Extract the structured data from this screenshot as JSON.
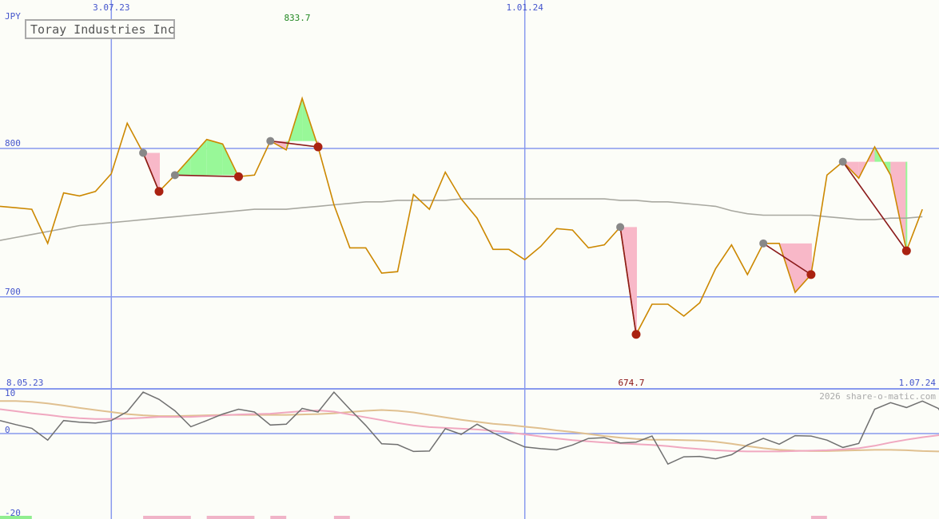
{
  "chart_data": {
    "type": "line",
    "title": "Toray Industries Inc",
    "currency": "JPY",
    "watermark": "2026 share-o-matic.com",
    "price_labels": {
      "high": "833.7",
      "low": "674.7"
    },
    "date_labels": {
      "start": "8.05.23",
      "end": "1.07.24"
    },
    "main_panel": {
      "y_ticks": [
        {
          "value": 800,
          "label": "800"
        },
        {
          "value": 700,
          "label": "700"
        }
      ],
      "ylim": [
        638,
        900
      ],
      "x_gridlines": [
        {
          "index": 7,
          "label": "3.07.23"
        },
        {
          "index": 33,
          "label": "1.01.24"
        }
      ],
      "series": [
        {
          "name": "",
          "color": "#cc8800",
          "values": [
            761,
            760,
            759,
            736,
            770,
            768,
            771,
            783,
            817,
            797,
            771,
            782,
            794,
            806,
            803,
            781,
            782,
            805,
            799,
            833.7,
            801,
            762,
            733,
            733,
            716,
            717,
            769,
            759,
            784,
            766,
            753,
            732,
            732,
            725,
            734,
            746,
            745,
            733,
            735,
            747,
            674.7,
            695,
            695,
            687,
            696,
            719,
            735,
            715,
            736,
            736,
            703,
            715,
            782,
            791,
            780,
            801,
            782,
            731,
            759
          ]
        },
        {
          "name": "",
          "color": "#a8a8a0",
          "values": [
            738,
            740,
            742,
            744,
            746,
            748,
            749,
            750,
            751,
            752,
            753,
            754,
            755,
            756,
            757,
            758,
            759,
            759,
            759,
            760,
            761,
            762,
            763,
            764,
            764,
            765,
            765,
            765,
            765,
            766,
            766,
            766,
            766,
            766,
            766,
            766,
            766,
            766,
            766,
            765,
            765,
            764,
            764,
            763,
            762,
            761,
            758,
            756,
            755,
            755,
            755,
            755,
            754,
            753,
            752,
            752,
            753,
            753,
            754
          ]
        }
      ],
      "signals": [
        {
          "type": "down",
          "from": 9,
          "to": 10
        },
        {
          "type": "up",
          "from": 11,
          "to": 15
        },
        {
          "type": "down",
          "from": 17,
          "to": 20
        },
        {
          "type": "down",
          "from": 39,
          "to": 40
        },
        {
          "type": "down",
          "from": 48,
          "to": 51
        },
        {
          "type": "up",
          "from": 53,
          "to": 57
        }
      ]
    },
    "osc_panel": {
      "y_ticks": [
        {
          "value": 10,
          "label": "10"
        },
        {
          "value": 0,
          "label": "0"
        },
        {
          "value": -20,
          "label": "-20"
        }
      ],
      "ylim": [
        -21,
        11
      ],
      "series": [
        {
          "name": "",
          "color": "#707070",
          "values": [
            3.2,
            2.2,
            1.3,
            -1.6,
            3.2,
            2.8,
            2.6,
            3.2,
            5.4,
            10.2,
            8.4,
            5.6,
            1.7,
            3.2,
            4.8,
            6.0,
            5.3,
            2.1,
            2.3,
            6.2,
            5.3,
            10.2,
            6.0,
            2.0,
            -2.5,
            -2.7,
            -4.4,
            -4.3,
            1.2,
            -0.2,
            2.3,
            0.2,
            -1.6,
            -3.3,
            -3.7,
            -4.0,
            -2.8,
            -1.2,
            -1.0,
            -2.3,
            -2.1,
            -0.6,
            -7.5,
            -5.7,
            -5.6,
            -6.2,
            -5.2,
            -2.8,
            -1.2,
            -2.6,
            -0.5,
            -0.6,
            -1.6,
            -3.4,
            -2.4,
            6.0,
            7.6,
            6.4,
            8.0,
            6.2,
            0.1,
            3.3
          ]
        },
        {
          "name": "",
          "color": "#f0a8c0",
          "values": [
            6.0,
            5.5,
            5.0,
            4.6,
            4.1,
            3.8,
            3.6,
            3.6,
            3.7,
            3.9,
            4.1,
            4.1,
            4.1,
            4.3,
            4.5,
            4.7,
            4.8,
            4.9,
            5.2,
            5.5,
            5.7,
            5.4,
            4.7,
            4.0,
            3.3,
            2.6,
            2.0,
            1.6,
            1.4,
            1.2,
            1.0,
            0.7,
            0.3,
            -0.2,
            -0.7,
            -1.2,
            -1.6,
            -1.9,
            -2.2,
            -2.4,
            -2.6,
            -2.8,
            -3.1,
            -3.5,
            -3.8,
            -4.1,
            -4.3,
            -4.4,
            -4.4,
            -4.4,
            -4.3,
            -4.2,
            -4.1,
            -3.9,
            -3.6,
            -3.0,
            -2.2,
            -1.5,
            -0.9,
            -0.4,
            -0.1,
            0.1
          ]
        },
        {
          "name": "",
          "color": "#e0c090",
          "values": [
            8.0,
            8.0,
            7.8,
            7.4,
            6.9,
            6.3,
            5.8,
            5.3,
            4.8,
            4.5,
            4.3,
            4.3,
            4.4,
            4.5,
            4.6,
            4.6,
            4.6,
            4.6,
            4.6,
            4.7,
            4.8,
            5.0,
            5.3,
            5.6,
            5.8,
            5.6,
            5.2,
            4.6,
            4.0,
            3.4,
            2.9,
            2.4,
            2.1,
            1.7,
            1.3,
            0.8,
            0.4,
            -0.1,
            -0.6,
            -1.0,
            -1.3,
            -1.5,
            -1.5,
            -1.6,
            -1.7,
            -2.0,
            -2.5,
            -3.1,
            -3.6,
            -4.0,
            -4.2,
            -4.3,
            -4.3,
            -4.2,
            -4.1,
            -4.0,
            -4.0,
            -4.1,
            -4.3,
            -4.4,
            -4.1,
            -3.2
          ]
        }
      ],
      "bottom_bars": [
        {
          "from": 0,
          "to": 2,
          "color": "#90ee90"
        },
        {
          "from": 9,
          "to": 12,
          "color": "#f0b4c8"
        },
        {
          "from": 13,
          "to": 16,
          "color": "#f0b4c8"
        },
        {
          "from": 17,
          "to": 18,
          "color": "#f0b4c8"
        },
        {
          "from": 21,
          "to": 22,
          "color": "#f0b4c8"
        },
        {
          "from": 51,
          "to": 52,
          "color": "#f0b4c8"
        }
      ]
    },
    "colors": {
      "grid": "#8899ee",
      "tick_label": "#4455cc",
      "high_label": "#228822",
      "low_label": "#881111",
      "up_fill": "#98f898",
      "down_fill": "#f8b8c8",
      "signal_line": "#8b1a1a",
      "marker_start": "#888888",
      "marker_end": "#aa2211",
      "title_border": "#aaaaaa",
      "watermark": "#aaaaaa"
    }
  }
}
